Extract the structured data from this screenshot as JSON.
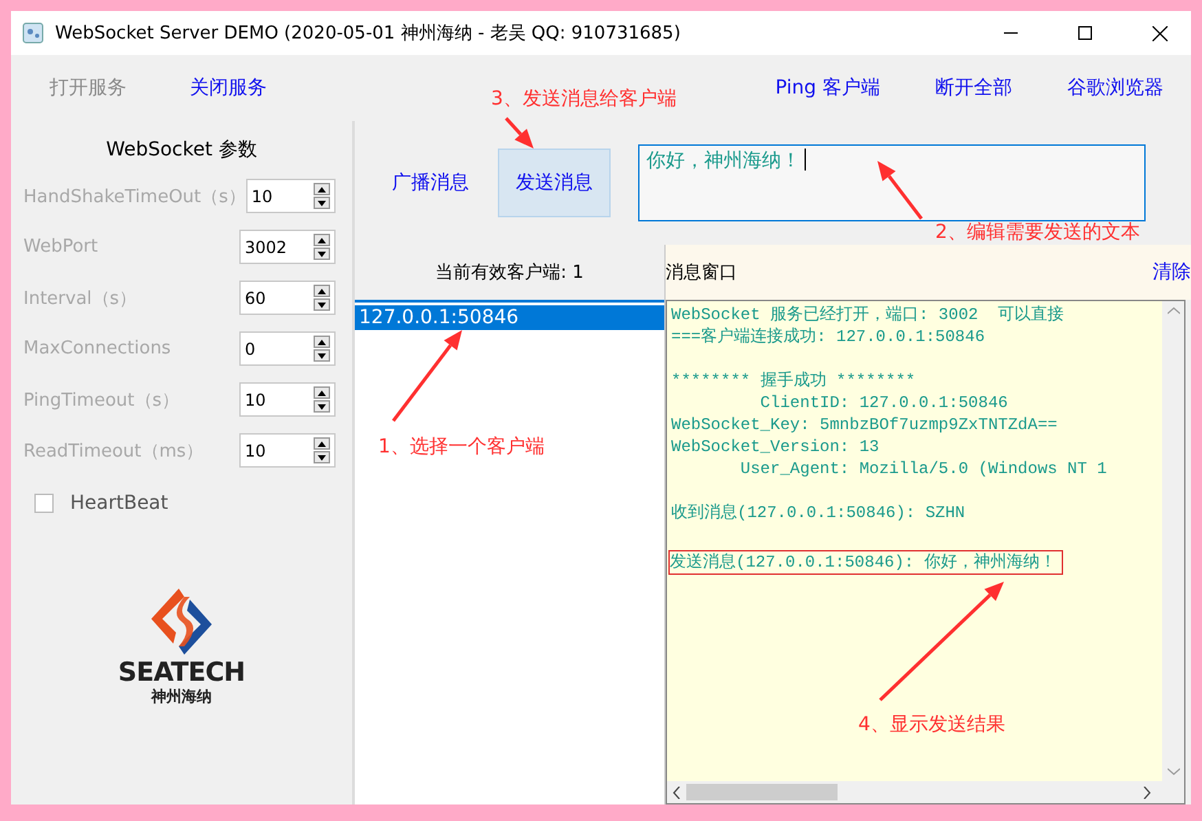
{
  "window": {
    "title": "WebSocket Server DEMO (2020-05-01 神州海纳 - 老吴 QQ: 910731685)"
  },
  "toolbar": {
    "left": [
      {
        "label": "打开服务",
        "disabled": true
      },
      {
        "label": "关闭服务",
        "disabled": false
      }
    ],
    "right": [
      {
        "label": "Ping 客户端",
        "disabled": false
      },
      {
        "label": "断开全部",
        "disabled": false
      },
      {
        "label": "谷歌浏览器",
        "disabled": false
      }
    ]
  },
  "settings": {
    "title": "WebSocket 参数",
    "fields": [
      {
        "label": "HandShakeTimeOut（s）",
        "value": "10"
      },
      {
        "label": "WebPort",
        "value": "3002"
      },
      {
        "label": "Interval（s）",
        "value": "60"
      },
      {
        "label": "MaxConnections",
        "value": "0"
      },
      {
        "label": "PingTimeout（s）",
        "value": "10"
      },
      {
        "label": "ReadTimeout（ms）",
        "value": "10"
      }
    ],
    "heartbeat": {
      "label": "HeartBeat",
      "checked": false
    }
  },
  "logo": {
    "name": "SEATECH",
    "subtitle": "神州海纳"
  },
  "actions": [
    {
      "label": "广播消息",
      "selected": false
    },
    {
      "label": "发送消息",
      "selected": true
    }
  ],
  "message_input": {
    "value": "你好，神州海纳！"
  },
  "clients": {
    "header": "当前有效客户端: 1",
    "items": [
      {
        "text": "127.0.0.1:50846",
        "selected": true
      }
    ]
  },
  "messages": {
    "header": "消息窗口",
    "clear": "清除",
    "blocks": [
      {
        "lines": [
          {
            "text": "WebSocket 服务已经打开，端口: 3002  可以直接",
            "boxed": false
          },
          {
            "text": "===客户端连接成功: 127.0.0.1:50846",
            "boxed": false
          }
        ]
      },
      {
        "lines": [
          {
            "text": "******** 握手成功 ********",
            "boxed": false
          },
          {
            "text": "         ClientID: 127.0.0.1:50846",
            "boxed": false
          },
          {
            "text": "WebSocket_Key: 5mnbzBOf7uzmp9ZxTNTZdA==",
            "boxed": false
          },
          {
            "text": "WebSocket_Version: 13",
            "boxed": false
          },
          {
            "text": "       User_Agent: Mozilla/5.0 (Windows NT 1",
            "boxed": false
          }
        ]
      },
      {
        "lines": [
          {
            "text": "收到消息(127.0.0.1:50846): SZHN",
            "boxed": false
          }
        ]
      },
      {
        "lines": [
          {
            "text": "发送消息(127.0.0.1:50846): 你好，神州海纳！",
            "boxed": true
          }
        ]
      }
    ]
  },
  "annotations": [
    {
      "text": "3、发送消息给客户端"
    },
    {
      "text": "2、编辑需要发送的文本"
    },
    {
      "text": "1、选择一个客户端"
    },
    {
      "text": "4、显示发送结果"
    }
  ]
}
